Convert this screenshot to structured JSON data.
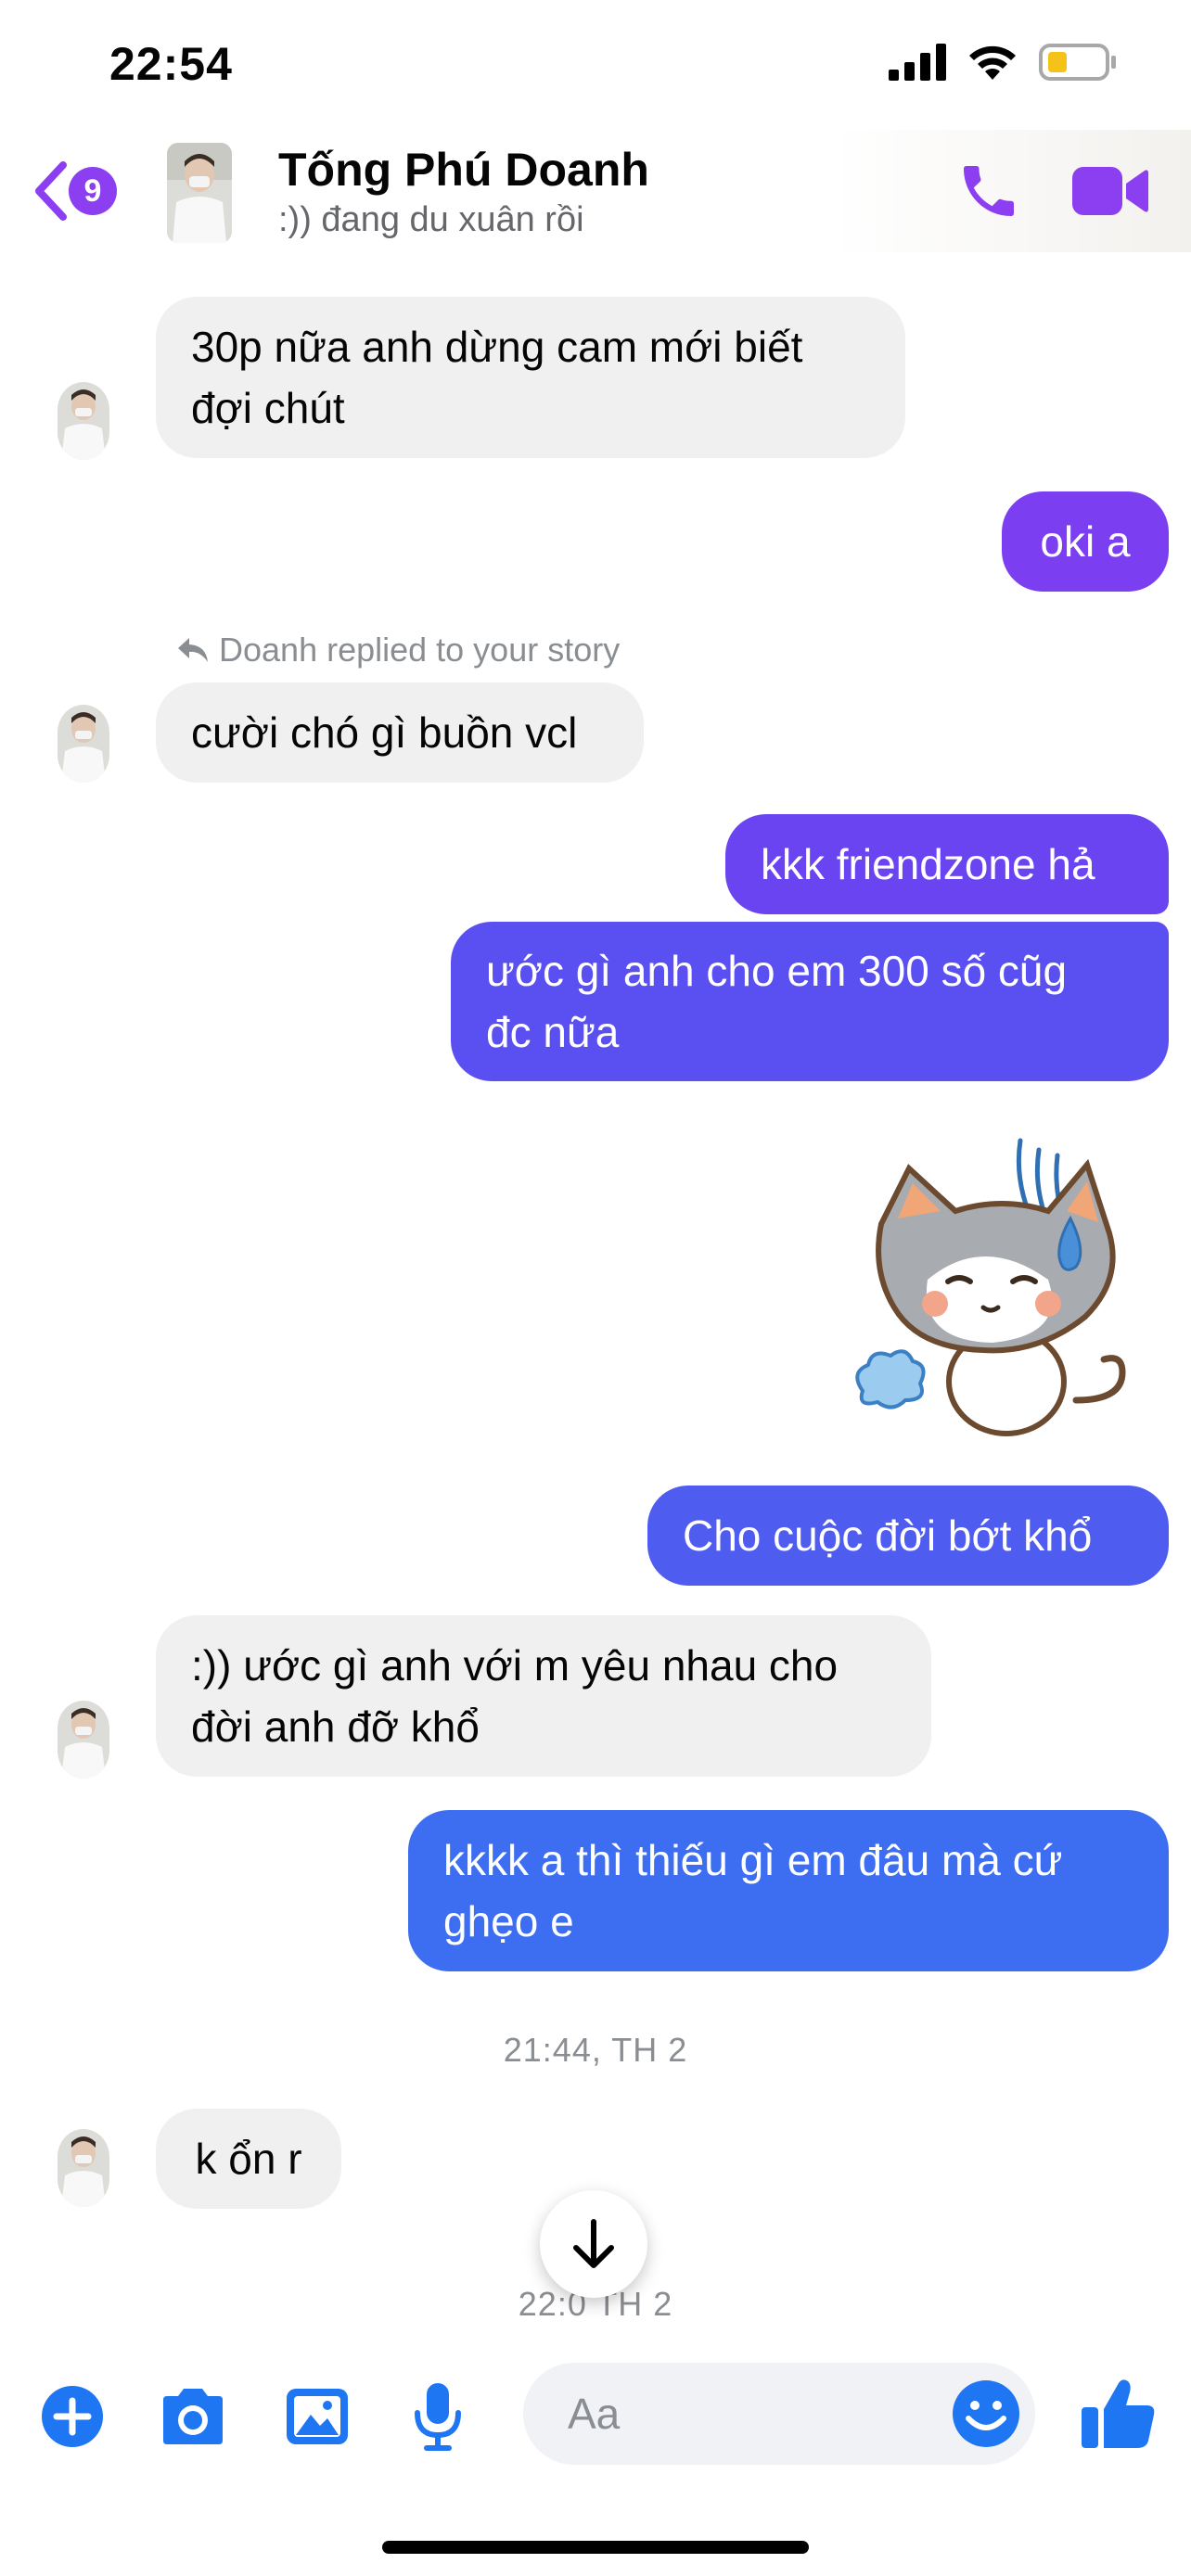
{
  "status_bar": {
    "time": "22:54"
  },
  "header": {
    "unread_count": "9",
    "contact_name": "Tống Phú Doanh",
    "contact_status": ":)) đang du xuân rồi"
  },
  "messages": {
    "m1": {
      "line1": "30p nữa anh dừng cam mới biết",
      "line2": "đợi chút"
    },
    "m2": "oki a",
    "reply_note": "Doanh replied to your story",
    "m3": "cười chó gì buồn vcl",
    "m4": "kkk friendzone hả",
    "m5": {
      "line1": "ước gì anh cho em 300 số cũg",
      "line2": "đc nữa"
    },
    "m6": "Cho cuộc đời bớt khổ",
    "m7": {
      "line1": ":)) ước gì anh với m yêu nhau cho",
      "line2": "đời anh đỡ khổ"
    },
    "m8": {
      "line1": "kkkk a thì thiếu gì em đâu mà cứ",
      "line2": "ghẹo e"
    },
    "time1": "21:44, TH 2",
    "m9": "k ổn r",
    "time2": "22:0  TH 2"
  },
  "composer": {
    "placeholder": "Aa"
  },
  "icons": {
    "back": "chevron-left-icon",
    "call": "phone-icon",
    "video": "video-camera-icon",
    "plus": "plus-icon",
    "camera": "camera-icon",
    "gallery": "image-icon",
    "mic": "microphone-icon",
    "emoji": "smiley-icon",
    "like": "thumbs-up-icon",
    "scroll": "arrow-down-icon",
    "reply": "reply-arrow-icon"
  },
  "colors": {
    "accent_purple": "#8b3ff0",
    "bubble_violet": "#7b3ff1",
    "bubble_indigo": "#5a4ff0",
    "bubble_blue": "#3d6ef2",
    "icon_blue": "#1f76f3",
    "incoming_bg": "#f0f0f0"
  }
}
